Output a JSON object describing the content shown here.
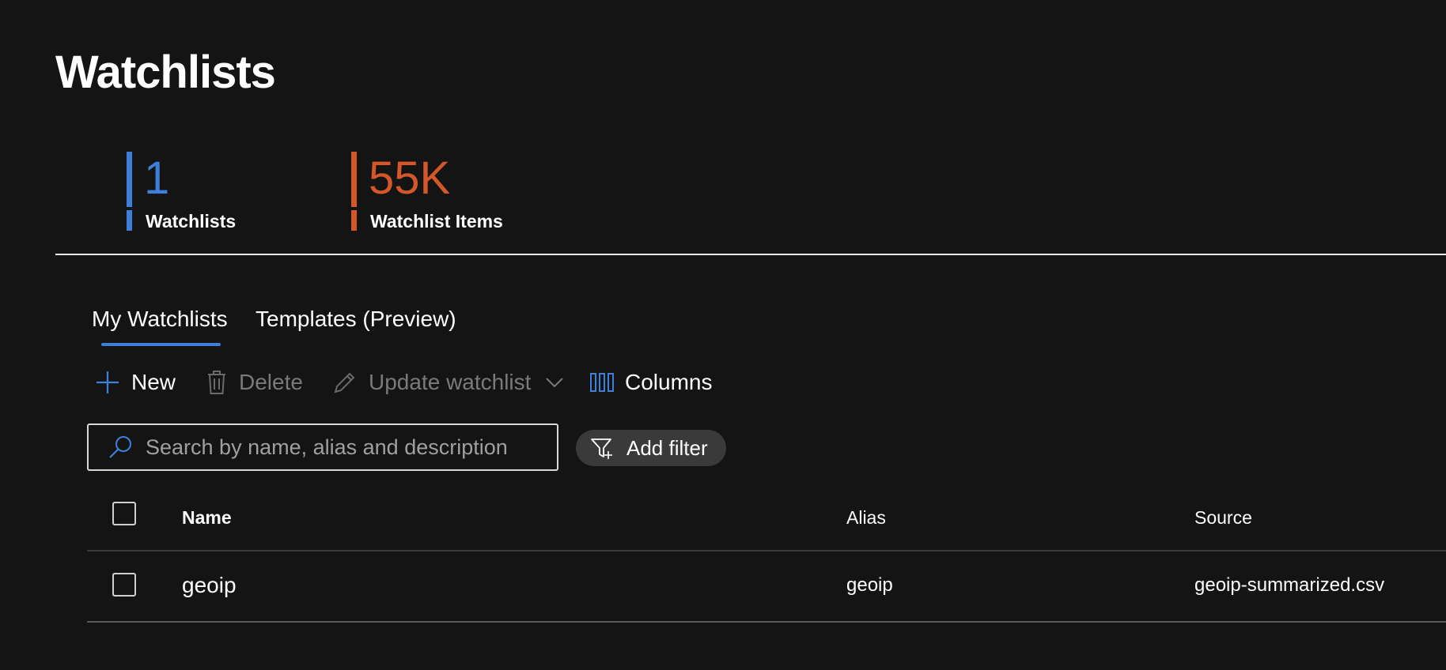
{
  "page": {
    "title": "Watchlists"
  },
  "metrics": [
    {
      "value": "1",
      "label": "Watchlists",
      "color": "#3f7fdc"
    },
    {
      "value": "55K",
      "label": "Watchlist Items",
      "color": "#d4572a"
    }
  ],
  "tabs": [
    {
      "label": "My Watchlists",
      "selected": true
    },
    {
      "label": "Templates (Preview)",
      "selected": false
    }
  ],
  "toolbar": {
    "new_label": "New",
    "delete_label": "Delete",
    "update_label": "Update watchlist",
    "columns_label": "Columns"
  },
  "search": {
    "placeholder": "Search by name, alias and description",
    "value": ""
  },
  "filter": {
    "label": "Add filter"
  },
  "table": {
    "columns": [
      "Name",
      "Alias",
      "Source"
    ],
    "rows": [
      {
        "name": "geoip",
        "alias": "geoip",
        "source": "geoip-summarized.csv"
      }
    ]
  },
  "icons": {
    "new": "plus-icon",
    "delete": "trash-icon",
    "update": "pencil-icon",
    "update_dropdown": "chevron-down-icon",
    "columns": "columns-icon",
    "search": "search-icon",
    "filter": "filter-add-icon"
  },
  "colors": {
    "accent": "#3f7fdc",
    "items_accent": "#d4572a",
    "background": "#141414"
  }
}
